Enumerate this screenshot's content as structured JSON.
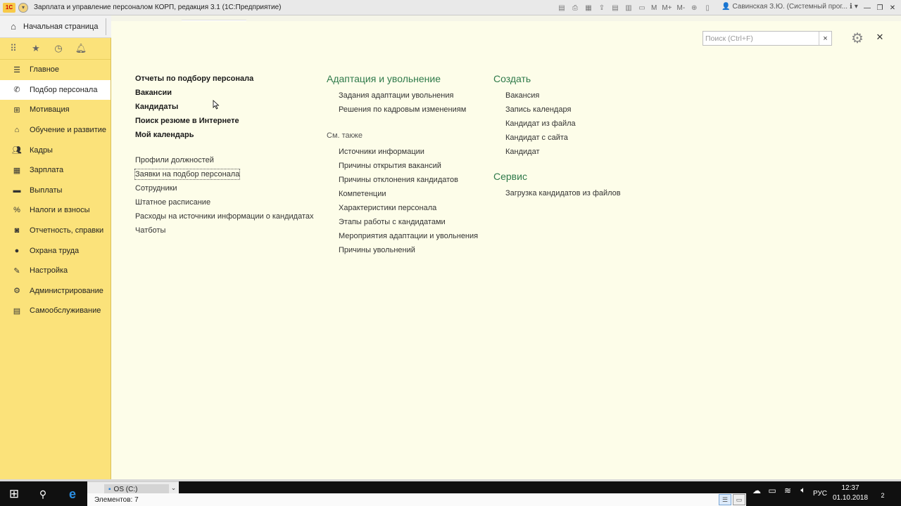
{
  "window": {
    "logo_text": "1С",
    "title": "Зарплата и управление персоналом КОРП, редакция 3.1  (1С:Предприятие)",
    "user": "Савинская З.Ю. (Системный прог...",
    "toolbar_letters": [
      "M",
      "M+",
      "M-"
    ]
  },
  "home": {
    "label": "Начальная страница"
  },
  "sidebar": {
    "items": [
      {
        "label": "Главное",
        "icon": "menu-icon"
      },
      {
        "label": "Подбор персонала",
        "icon": "phone-icon"
      },
      {
        "label": "Мотивация",
        "icon": "gift-icon"
      },
      {
        "label": "Обучение и развитие",
        "icon": "graduation-icon"
      },
      {
        "label": "Кадры",
        "icon": "people-icon"
      },
      {
        "label": "Зарплата",
        "icon": "calculator-icon"
      },
      {
        "label": "Выплаты",
        "icon": "wallet-icon"
      },
      {
        "label": "Налоги и взносы",
        "icon": "percent-icon"
      },
      {
        "label": "Отчетность, справки",
        "icon": "report-icon"
      },
      {
        "label": "Охрана труда",
        "icon": "helmet-icon"
      },
      {
        "label": "Настройка",
        "icon": "wrench-icon"
      },
      {
        "label": "Администрирование",
        "icon": "gear-icon"
      },
      {
        "label": "Самообслуживание",
        "icon": "id-card-icon"
      }
    ],
    "active_index": 1
  },
  "search": {
    "placeholder": "Поиск (Ctrl+F)",
    "value": ""
  },
  "main": {
    "col1": {
      "bold_links": [
        "Отчеты по подбору персонала",
        "Вакансии",
        "Кандидаты",
        "Поиск резюме в Интернете",
        "Мой календарь"
      ],
      "links": [
        "Профили должностей",
        "Заявки на подбор персонала",
        "Сотрудники",
        "Штатное расписание",
        "Расходы на источники информации о кандидатах",
        "Чатботы"
      ],
      "focused_link_index": 1
    },
    "col2": {
      "title": "Адаптация и увольнение",
      "links": [
        "Задания адаптации увольнения",
        "Решения по кадровым изменениям"
      ],
      "see_also": "См. также",
      "see_also_links": [
        "Источники информации",
        "Причины открытия вакансий",
        "Причины отклонения кандидатов",
        "Компетенции",
        "Характеристики персонала",
        "Этапы работы с кандидатами",
        "Мероприятия адаптации и увольнения",
        "Причины увольнений"
      ]
    },
    "col3": {
      "create_title": "Создать",
      "create_links": [
        "Вакансия",
        "Запись календаря",
        "Кандидат из файла",
        "Кандидат с сайта",
        "Кандидат"
      ],
      "service_title": "Сервис",
      "service_links": [
        "Загрузка кандидатов из файлов"
      ]
    }
  },
  "explorer": {
    "drive": "OS (C:)",
    "status": "Элементов: 7"
  },
  "taskbar": {
    "lang": "РУС",
    "time": "12:37",
    "date": "01.10.2018",
    "notifications": "2"
  }
}
